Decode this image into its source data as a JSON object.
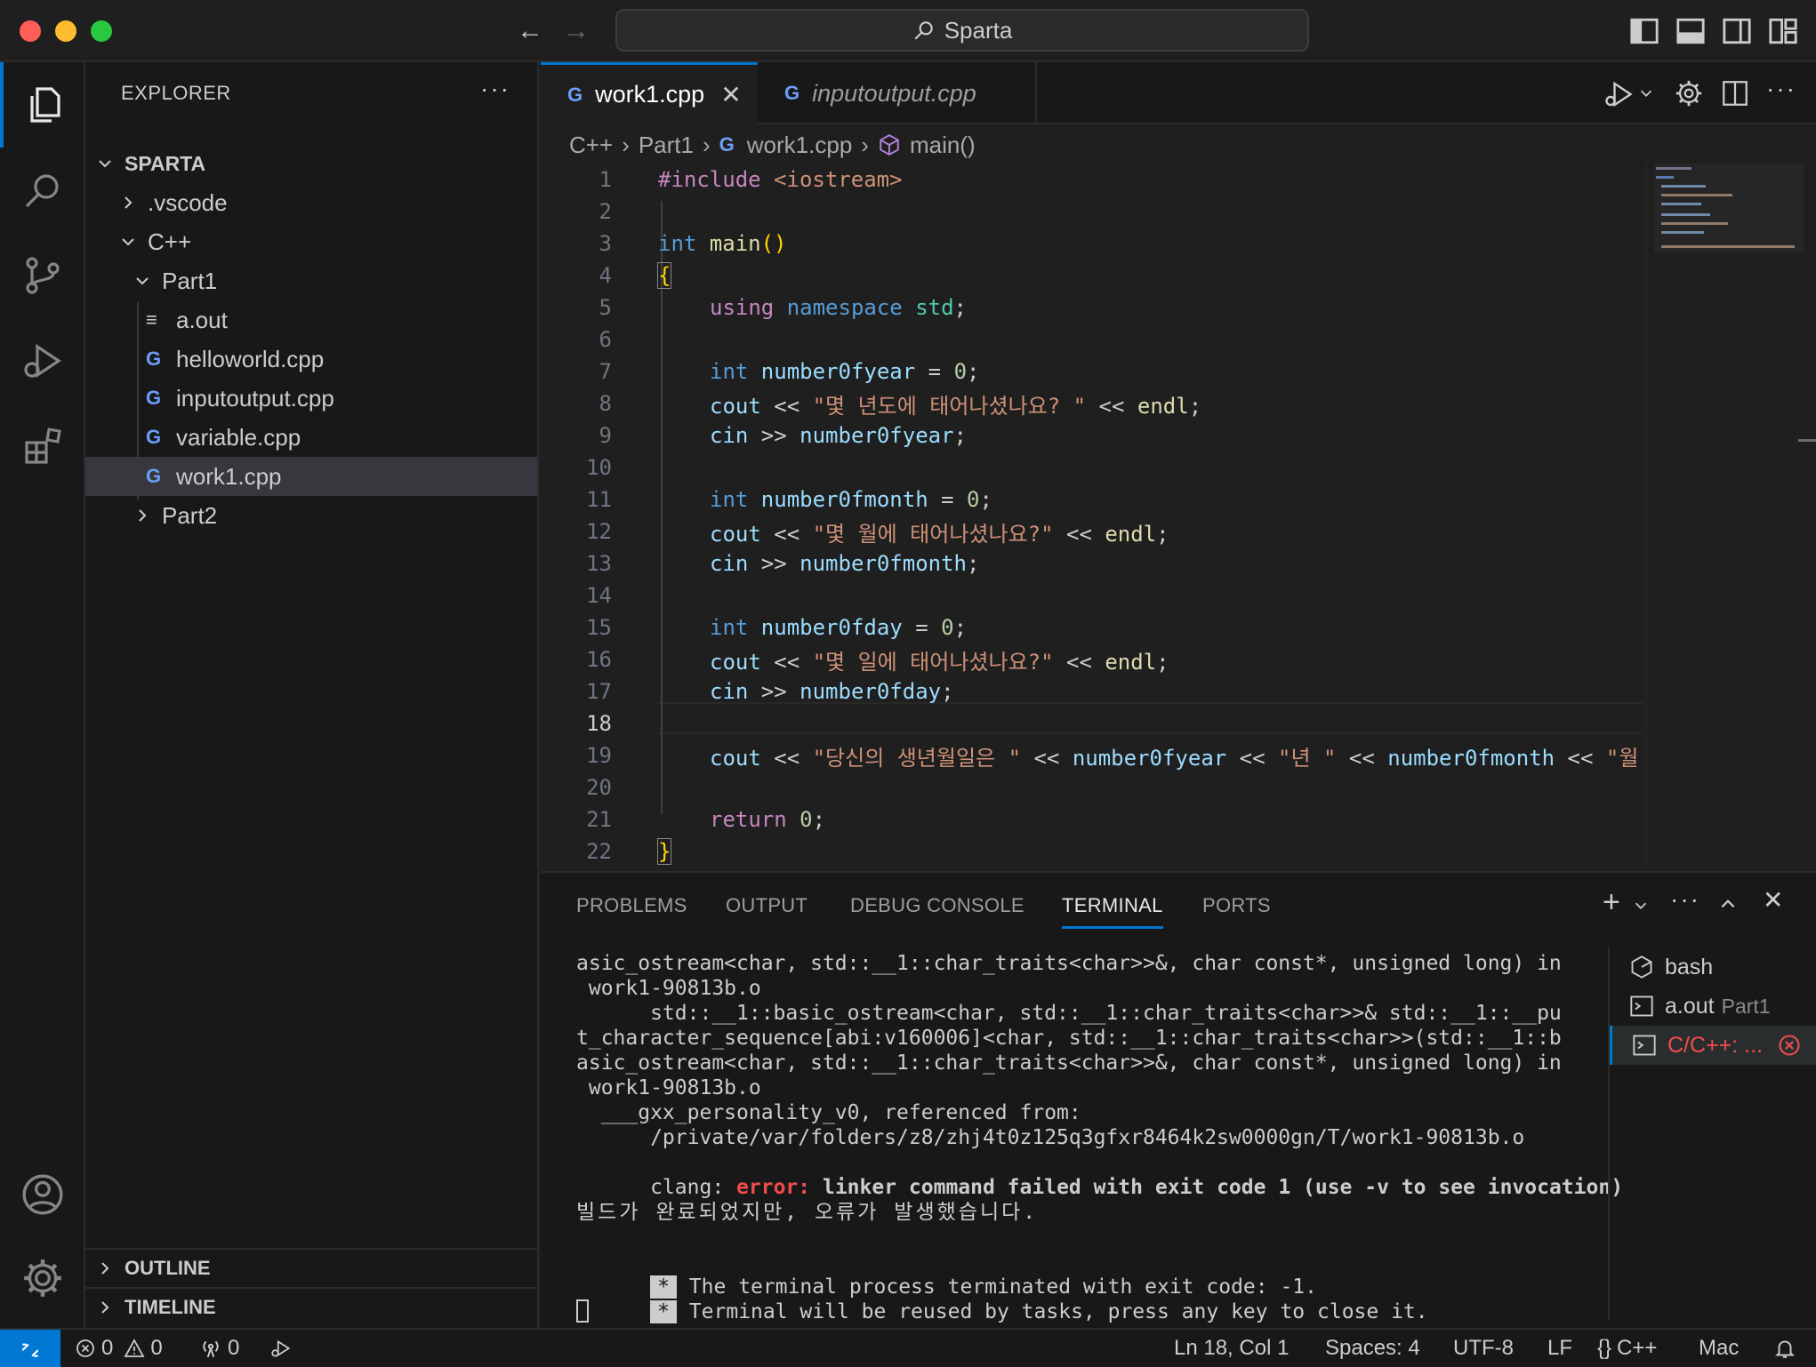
{
  "titlebar": {
    "search_text": "Sparta"
  },
  "sidebar": {
    "header": "EXPLORER",
    "root": "SPARTA",
    "tree": [
      {
        "label": ".vscode",
        "kind": "folder-closed"
      },
      {
        "label": "C++",
        "kind": "folder-open"
      },
      {
        "label": "Part1",
        "kind": "folder-open"
      },
      {
        "label": "a.out",
        "kind": "file-text"
      },
      {
        "label": "helloworld.cpp",
        "kind": "file-cpp"
      },
      {
        "label": "inputoutput.cpp",
        "kind": "file-cpp"
      },
      {
        "label": "variable.cpp",
        "kind": "file-cpp"
      },
      {
        "label": "work1.cpp",
        "kind": "file-cpp"
      },
      {
        "label": "Part2",
        "kind": "folder-closed"
      }
    ],
    "outline": "OUTLINE",
    "timeline": "TIMELINE"
  },
  "tabs": [
    {
      "label": "work1.cpp",
      "active": true
    },
    {
      "label": "inputoutput.cpp",
      "active": false
    }
  ],
  "breadcrumb": [
    "C++",
    "Part1",
    "work1.cpp",
    "main()"
  ],
  "code": {
    "line_numbers": [
      "1",
      "2",
      "3",
      "4",
      "5",
      "6",
      "7",
      "8",
      "9",
      "10",
      "11",
      "12",
      "13",
      "14",
      "15",
      "16",
      "17",
      "18",
      "19",
      "20",
      "21",
      "22"
    ],
    "current_line": "18",
    "lines": {
      "l1_kw": "#include",
      "l1_inc": " <iostream>",
      "l3_kw": "int",
      "l3_fn": " main",
      "l3_paren": "()",
      "l4": "{",
      "l5_using": "using",
      "l5_ns": " namespace",
      "l5_std": " std",
      "l5_semi": ";",
      "l7_kw": "int",
      "l7_var": " number0fyear",
      "l7_rest": " = ",
      "l7_num": "0",
      "l8_var": "cout",
      "l8_op": " << ",
      "l8_str": "\"몇 년도에 태어나셨나요? \"",
      "l8_op2": " << ",
      "l8_var2": "endl",
      "l9_var": "cin",
      "l9_op": " >> ",
      "l9_var2": "number0fyear",
      "l11_var": " number0fmonth",
      "l12_str": "\"몇 월에 태어나셨나요?\"",
      "l13_var2": "number0fmonth",
      "l15_var": " number0fday",
      "l16_str": "\"몇 일에 태어나셨나요?\"",
      "l17_var2": "number0fday",
      "l19_str1": "\"당신의 생년월일은 \"",
      "l19_var1": "number0fyear",
      "l19_str2": "\"년 \"",
      "l19_var2": "number0fmonth",
      "l19_str3": "\"월 '",
      "l21_kw": "return",
      "l21_num": " 0",
      "l22": "}",
      "semi": ";"
    }
  },
  "panel": {
    "tabs": [
      "PROBLEMS",
      "OUTPUT",
      "DEBUG CONSOLE",
      "TERMINAL",
      "PORTS"
    ],
    "active_tab": "TERMINAL",
    "terminal_lines": [
      "asic_ostream<char, std::__1::char_traits<char>>&, char const*, unsigned long) in",
      " work1-90813b.o",
      "      std::__1::basic_ostream<char, std::__1::char_traits<char>>& std::__1::__pu",
      "t_character_sequence[abi:v160006]<char, std::__1::char_traits<char>>(std::__1::b",
      "asic_ostream<char, std::__1::char_traits<char>>&, char const*, unsigned long) in",
      " work1-90813b.o",
      "  ___gxx_personality_v0, referenced from:",
      "      /private/var/folders/z8/zhj4t0z125q3gfxr8464k2sw0000gn/T/work1-90813b.o"
    ],
    "clang_prefix": "clang: ",
    "clang_error": "error:",
    "clang_msg": " linker command failed with exit code 1 (use -v to see invocation)",
    "build_msg": "빌드가 완료되었지만, 오류가 발생했습니다.",
    "star": "*",
    "exit_line1": " The terminal process terminated with exit code: -1.",
    "exit_line2": " Terminal will be reused by tasks, press any key to close it.",
    "terminals": [
      {
        "name": "bash",
        "sub": ""
      },
      {
        "name": "a.out",
        "sub": "Part1"
      },
      {
        "name": "C/C++: ...",
        "sub": ""
      }
    ]
  },
  "statusbar": {
    "errors": "0",
    "warnings": "0",
    "ports": "0",
    "position": "Ln 18, Col 1",
    "spaces": "Spaces: 4",
    "encoding": "UTF-8",
    "eol": "LF",
    "language": "C++",
    "platform": "Mac"
  },
  "colors": {
    "accent": "#0078d4",
    "error": "#f14c4c",
    "remote": "#0078d4"
  }
}
